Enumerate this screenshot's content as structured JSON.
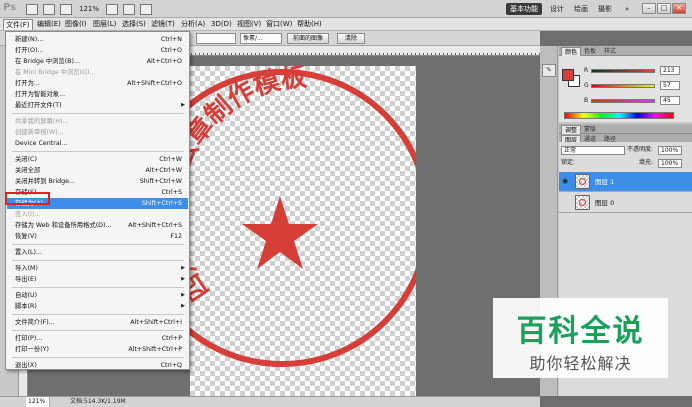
{
  "app": {
    "logo": "Ps",
    "zoom": "121%",
    "workspace_active": "基本功能",
    "workspaces": [
      "设计",
      "绘画",
      "摄影"
    ],
    "more": "»"
  },
  "window_controls": {
    "minimize": "–",
    "restore": "□",
    "close": "✕"
  },
  "menubar": [
    "文件(F)",
    "编辑(E)",
    "图像(I)",
    "图层(L)",
    "选择(S)",
    "滤镜(T)",
    "分析(A)",
    "3D(D)",
    "视图(V)",
    "窗口(W)",
    "帮助(H)"
  ],
  "options_bar": {
    "style_value": "像素/...",
    "refine_button": "前面的图像",
    "clear_button": "清除"
  },
  "file_menu": [
    {
      "label": "新建(N)...",
      "shortcut": "Ctrl+N",
      "enabled": true
    },
    {
      "label": "打开(O)...",
      "shortcut": "Ctrl+O",
      "enabled": true
    },
    {
      "label": "在 Bridge 中浏览(B)...",
      "shortcut": "Alt+Ctrl+O",
      "enabled": true
    },
    {
      "label": "在 Mini Bridge 中浏览(G)...",
      "shortcut": "",
      "enabled": false
    },
    {
      "label": "打开为...",
      "shortcut": "Alt+Shift+Ctrl+O",
      "enabled": true
    },
    {
      "label": "打开为智能对象...",
      "shortcut": "",
      "enabled": true
    },
    {
      "label": "最近打开文件(T)",
      "shortcut": "",
      "enabled": true,
      "submenu": true
    },
    {
      "separator": true
    },
    {
      "label": "共享我的屏幕(H)...",
      "shortcut": "",
      "enabled": false
    },
    {
      "label": "创建新审核(W)...",
      "shortcut": "",
      "enabled": false
    },
    {
      "label": "Device Central...",
      "shortcut": "",
      "enabled": true
    },
    {
      "separator": true
    },
    {
      "label": "关闭(C)",
      "shortcut": "Ctrl+W",
      "enabled": true
    },
    {
      "label": "关闭全部",
      "shortcut": "Alt+Ctrl+W",
      "enabled": true
    },
    {
      "label": "关闭并转到 Bridge...",
      "shortcut": "Shift+Ctrl+W",
      "enabled": true
    },
    {
      "label": "存储(S)",
      "shortcut": "Ctrl+S",
      "enabled": true
    },
    {
      "label": "存储为(A)...",
      "shortcut": "Shift+Ctrl+S",
      "enabled": true,
      "selected": true
    },
    {
      "label": "签入(I)...",
      "shortcut": "",
      "enabled": false
    },
    {
      "label": "存储为 Web 和设备所用格式(D)...",
      "shortcut": "Alt+Shift+Ctrl+S",
      "enabled": true
    },
    {
      "label": "恢复(V)",
      "shortcut": "F12",
      "enabled": true
    },
    {
      "separator": true
    },
    {
      "label": "置入(L)...",
      "shortcut": "",
      "enabled": true
    },
    {
      "separator": true
    },
    {
      "label": "导入(M)",
      "shortcut": "",
      "enabled": true,
      "submenu": true
    },
    {
      "label": "导出(E)",
      "shortcut": "",
      "enabled": true,
      "submenu": true
    },
    {
      "separator": true
    },
    {
      "label": "自动(U)",
      "shortcut": "",
      "enabled": true,
      "submenu": true
    },
    {
      "label": "脚本(R)",
      "shortcut": "",
      "enabled": true,
      "submenu": true
    },
    {
      "separator": true
    },
    {
      "label": "文件简介(F)...",
      "shortcut": "Alt+Shift+Ctrl+I",
      "enabled": true
    },
    {
      "separator": true
    },
    {
      "label": "打印(P)...",
      "shortcut": "Ctrl+P",
      "enabled": true
    },
    {
      "label": "打印一份(Y)",
      "shortcut": "Alt+Shift+Ctrl+P",
      "enabled": true
    },
    {
      "separator": true
    },
    {
      "label": "退出(X)",
      "shortcut": "Ctrl+Q",
      "enabled": true
    }
  ],
  "color_panel": {
    "tabs": [
      "颜色",
      "色板",
      "样式"
    ],
    "foreground": "#d63e38",
    "background": "#ffffff",
    "r": {
      "label": "R",
      "value": "213"
    },
    "g": {
      "label": "G",
      "value": "57"
    },
    "b": {
      "label": "B",
      "value": "45"
    }
  },
  "adjust_tabs": [
    "调整",
    "蒙版"
  ],
  "layers_panel": {
    "tabs": [
      "图层",
      "通道",
      "路径"
    ],
    "blend_mode": "正常",
    "opacity_label": "不透明度:",
    "opacity_value": "100%",
    "lock_label": "锁定:",
    "fill_label": "填充:",
    "fill_value": "100%",
    "layers": [
      {
        "name": "图层 1",
        "visible": true,
        "selected": true
      },
      {
        "name": "图层 0",
        "visible": false,
        "selected": false
      }
    ]
  },
  "canvas": {
    "seal_text": "四川主尚的公章制作模板"
  },
  "status": {
    "zoom": "121%",
    "doc_info": "文档:514.3K/1.19M"
  },
  "watermark": {
    "logo": "百科全说",
    "subtitle": "助你轻松解决"
  }
}
